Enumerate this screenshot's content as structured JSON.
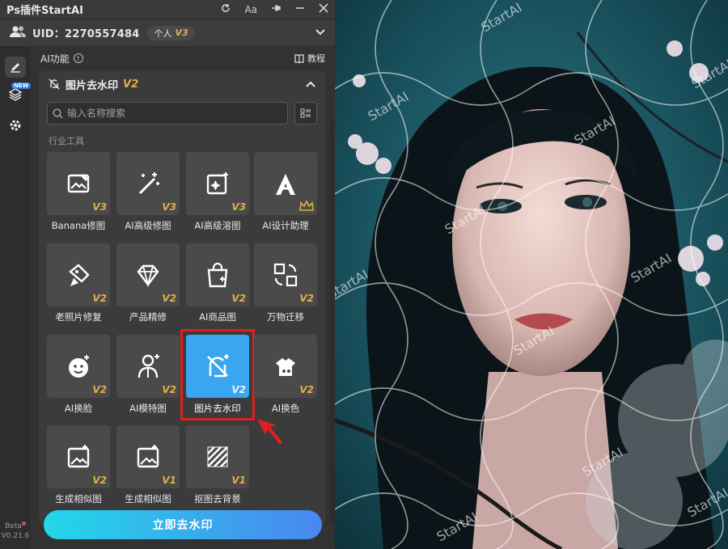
{
  "window": {
    "title": "Ps插件StartAI"
  },
  "titlebar_icons": [
    "refresh-icon",
    "font-size-icon",
    "pin-icon",
    "minimize-icon",
    "close-icon"
  ],
  "titlebar_font_label": "Aa",
  "user": {
    "uid_label": "UID：2270557484",
    "plan": "个人",
    "plan_version": "V3"
  },
  "rail": {
    "new_badge": "NEW",
    "beta_label": "Beta",
    "version": "V0.21.6"
  },
  "section": {
    "title": "AI功能",
    "info": "!",
    "tutorial": "教程"
  },
  "tool": {
    "name": "图片去水印",
    "version": "V2"
  },
  "search": {
    "placeholder": "输入名称搜索"
  },
  "category": "行业工具",
  "tiles": [
    {
      "label": "Banana修图",
      "version": "V3",
      "icon": "image-edit-icon"
    },
    {
      "label": "AI高级修图",
      "version": "V3",
      "icon": "magic-wand-icon"
    },
    {
      "label": "AI高级溶图",
      "version": "V3",
      "icon": "image-sparkle-icon"
    },
    {
      "label": "AI设计助理",
      "version": "",
      "icon": "design-assistant-icon"
    },
    {
      "label": "老照片修复",
      "version": "V2",
      "icon": "photo-repair-icon"
    },
    {
      "label": "产品精修",
      "version": "V2",
      "icon": "diamond-icon"
    },
    {
      "label": "AI商品图",
      "version": "V2",
      "icon": "shopping-bag-icon"
    },
    {
      "label": "万物迁移",
      "version": "V2",
      "icon": "transfer-icon"
    },
    {
      "label": "AI换脸",
      "version": "V2",
      "icon": "face-swap-icon"
    },
    {
      "label": "AI模特图",
      "version": "V2",
      "icon": "model-icon"
    },
    {
      "label": "图片去水印",
      "version": "V2",
      "icon": "watermark-remove-icon",
      "selected": true
    },
    {
      "label": "AI换色",
      "version": "V2",
      "icon": "recolor-icon"
    },
    {
      "label": "生成相似图",
      "version": "V2",
      "icon": "similar-image-icon"
    },
    {
      "label": "生成相似图",
      "version": "V1",
      "icon": "similar-image-icon"
    },
    {
      "label": "抠图去背景",
      "version": "V1",
      "icon": "remove-background-icon"
    }
  ],
  "action": {
    "label": "立即去水印"
  },
  "canvas": {
    "watermark_text": "StartAI"
  },
  "colors": {
    "accent": "#3aa5f0",
    "highlight": "#e02020",
    "version_gold": "#e0b04a",
    "button_start": "#22d8e8",
    "button_end": "#4a86f0"
  }
}
